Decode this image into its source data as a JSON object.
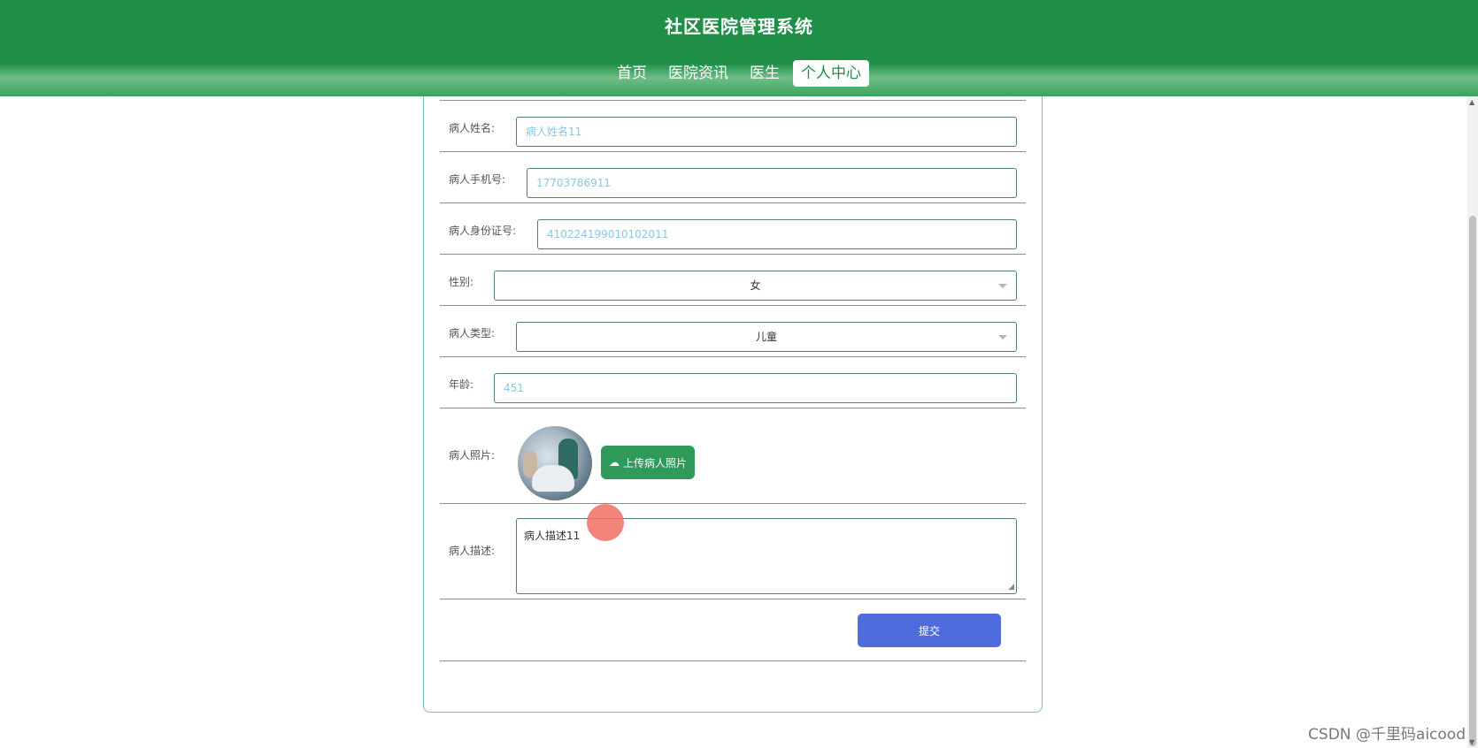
{
  "header": {
    "title": "社区医院管理系统",
    "nav": [
      {
        "label": "首页",
        "active": false
      },
      {
        "label": "医院资讯",
        "active": false
      },
      {
        "label": "医生",
        "active": false
      },
      {
        "label": "个人中心",
        "active": true
      }
    ]
  },
  "form": {
    "patient_name": {
      "label": "病人姓名:",
      "value": "病人姓名11"
    },
    "patient_phone": {
      "label": "病人手机号:",
      "value": "17703786911"
    },
    "patient_id_card": {
      "label": "病人身份证号:",
      "value": "410224199010102011"
    },
    "gender": {
      "label": "性别:",
      "value": "女"
    },
    "patient_type": {
      "label": "病人类型:",
      "value": "儿童"
    },
    "age": {
      "label": "年龄:",
      "value": "451"
    },
    "photo": {
      "label": "病人照片:",
      "upload_label": "上传病人照片"
    },
    "description": {
      "label": "病人描述:",
      "value": "病人描述11"
    },
    "submit_label": "提交"
  },
  "watermark": "CSDN @千里码aicood",
  "colors": {
    "header_green": "#1f8f48",
    "upload_green": "#2f9a5a",
    "submit_blue": "#4f6bdc",
    "input_text": "#8ec5e0"
  },
  "icons": {
    "upload": "cloud-upload-icon",
    "dropdown": "chevron-down-icon"
  }
}
